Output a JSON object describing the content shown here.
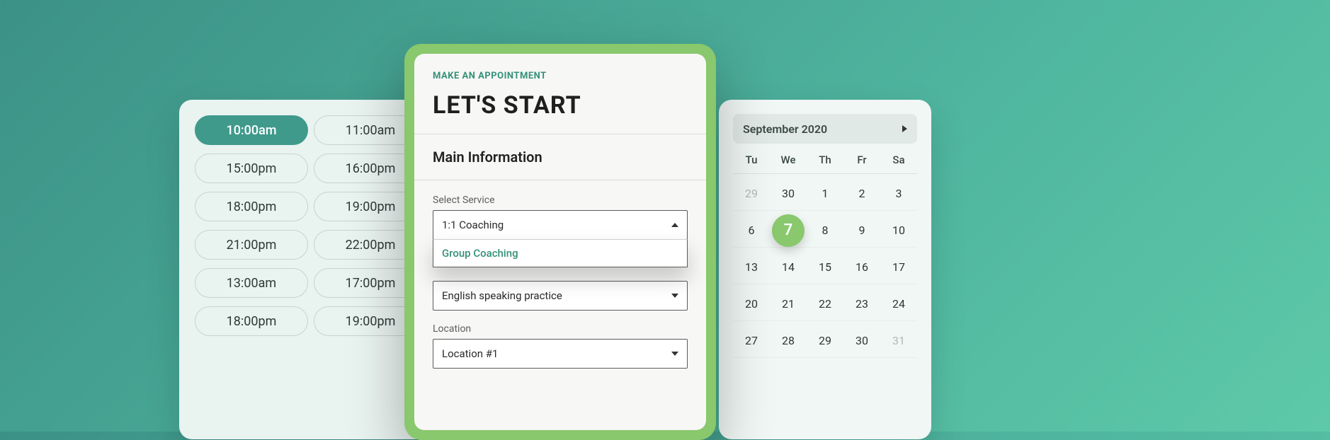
{
  "time_slots": {
    "rows": [
      [
        "10:00am",
        "11:00am"
      ],
      [
        "15:00pm",
        "16:00pm"
      ],
      [
        "18:00pm",
        "19:00pm"
      ],
      [
        "21:00pm",
        "22:00pm"
      ],
      [
        "13:00am",
        "17:00pm"
      ],
      [
        "18:00pm",
        "19:00pm"
      ]
    ],
    "selected": "10:00am"
  },
  "appointment": {
    "eyebrow": "MAKE AN APPOINTMENT",
    "headline": "LET'S START",
    "section": "Main Information",
    "service": {
      "label": "Select Service",
      "value": "1:1 Coaching",
      "options": [
        "Group Coaching"
      ]
    },
    "subject": {
      "value": "English speaking practice"
    },
    "location": {
      "label": "Location",
      "value": "Location #1"
    }
  },
  "calendar": {
    "title": "September 2020",
    "dow": [
      "Tu",
      "We",
      "Th",
      "Fr",
      "Sa"
    ],
    "weeks": [
      [
        {
          "d": "29",
          "muted": true
        },
        {
          "d": "30"
        },
        {
          "d": "1"
        },
        {
          "d": "2"
        },
        {
          "d": "3"
        }
      ],
      [
        {
          "d": "6"
        },
        {
          "d": "7",
          "selected": true
        },
        {
          "d": "8"
        },
        {
          "d": "9"
        },
        {
          "d": "10"
        }
      ],
      [
        {
          "d": "13"
        },
        {
          "d": "14"
        },
        {
          "d": "15"
        },
        {
          "d": "16"
        },
        {
          "d": "17"
        }
      ],
      [
        {
          "d": "20"
        },
        {
          "d": "21"
        },
        {
          "d": "22"
        },
        {
          "d": "23"
        },
        {
          "d": "24"
        }
      ],
      [
        {
          "d": "27"
        },
        {
          "d": "28"
        },
        {
          "d": "29"
        },
        {
          "d": "30"
        },
        {
          "d": "31",
          "muted": true
        }
      ]
    ]
  }
}
